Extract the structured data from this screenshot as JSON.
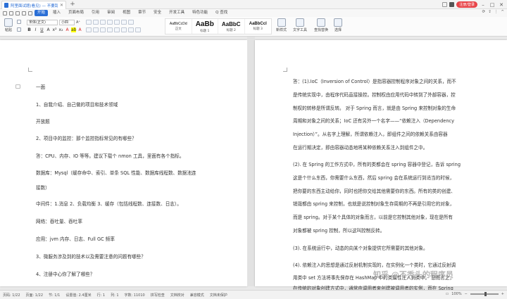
{
  "titlebar": {
    "tab_title": "阿里面试题(看见) — 不要乱答_Dock",
    "user_button": "注册/登录"
  },
  "menu": {
    "items": [
      "开始",
      "插入",
      "页面布局",
      "引用",
      "审阅",
      "视图",
      "章节",
      "安全",
      "开发工具",
      "特色功能",
      "Q 查找"
    ],
    "active_index": 0
  },
  "ribbon": {
    "paste": "粘贴",
    "cut": "剪切",
    "copy": "复制",
    "format_painter": "格式刷",
    "font_name": "宋体(正文)",
    "font_size": "小四",
    "styles": [
      {
        "sample": "AaBbCcDd",
        "name": "正文"
      },
      {
        "sample": "AaBb",
        "name": "标题 1"
      },
      {
        "sample": "AaBbC",
        "name": "标题 2"
      },
      {
        "sample": "AaBbCcl",
        "name": "标题 3"
      }
    ],
    "new_style": "新样式",
    "text_tools": "文字工具",
    "find_replace": "查找替换",
    "select": "选择"
  },
  "left_page": [
    "一面",
    "1、自我介绍、自己做的项目和技术领域",
    "开放题",
    "2、项目中的监控：那个监控指标常见的有哪些？",
    "答：CPU、内存、IO 等等。建议下载个 nmon 工具，里面有各个指标。",
    "数据库：Mysql（缓存命中、索引、单条 SQL 性能、数据库线程数、数据池连",
    "接数）",
    "中间件：1.消息 2、负载均衡 3、缓存（包括线程数、连接数、日志）。",
    "网络：吞吐量、吞吐率",
    "应用：jvm 内存、日志、Full GC 频率",
    "3、微服务涉及到的技术以及需要注意的问题有哪些？",
    "4、注册中心你了解了哪些？"
  ],
  "right_page": [
    "答：(1).IoC（Inversion of Control）是指容器控制程序对象之间的关系，而不",
    "是传统实现中，由程序代码直接操控。控制权由应用代码中转到了外部容器，控",
    "制权的转移是所谓反转。 对于 Spring 而言，就是由 Spring 来控制对象的生命",
    "周期和对象之间的关系；IoC 还有另外一个名字——“依赖注入（Dependency",
    "Injection）”。从名字上理解，所谓依赖注入，即组件之间的依赖关系由容器",
    "在运行期决定，即由容器动态地将某种依赖关系注入到组件之中。",
    "(2). 在 Spring 的工作方式中，所有的类都会在 spring 容器中登记，告诉 spring",
    "这是个什么东西，你需要什么东西，然后 spring 会在系统运行到适当的时候，",
    "把你要的东西主动给你，同时也把你交给其他需要你的东西。所有的类的创建、",
    "销毁都由 spring 来控制，也就是说控制对象生存周期的不再是引用它的对象，",
    "而是 spring。对于某个具体的对象而言，以前是它控制其他对象，现在是所有",
    "对象都被 spring 控制，所以这叫控制反转。",
    "(3). 在系统运行中，动态的向某个对象提供它所需要的其他对象。",
    "(4). 依赖注入的思想是通过反射机制实现的，在实例化一个类时，它通过反射调",
    "用类中 set 方法将事先保存在 HashMap 中的类属性注入到类中。 总而言之，",
    "在传统的对象创建方式中，通常由调用者来创建被调用者的实例，而在 Spring"
  ],
  "watermark": "知乎 @不秃头的程序员",
  "status": {
    "page": "页码: 1/22",
    "pages": "页面: 1/22",
    "section": "节: 1/1",
    "position": "设置值: 2.4厘米",
    "row": "行: 1",
    "col": "列: 1",
    "words": "字数: 11010",
    "spell": "拼写检查",
    "doc_check": "文档校对",
    "compat": "兼容模式",
    "protect": "文档未保护",
    "zoom": "100%"
  }
}
